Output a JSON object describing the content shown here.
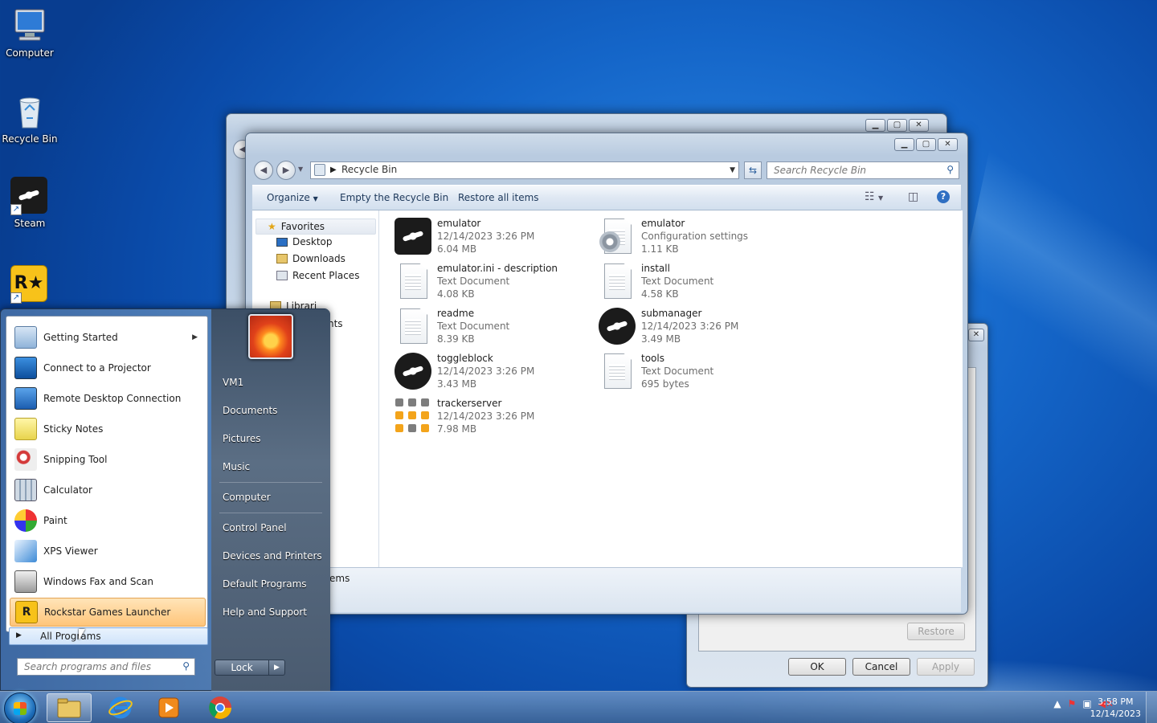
{
  "desktop": {
    "icons": [
      {
        "label": "Computer"
      },
      {
        "label": "Recycle Bin"
      },
      {
        "label": "Steam"
      },
      {
        "label": "Rockstar"
      }
    ]
  },
  "explorer": {
    "address": "Recycle Bin",
    "search_placeholder": "Search Recycle Bin",
    "toolbar": {
      "organize": "Organize",
      "empty": "Empty the Recycle Bin",
      "restore_all": "Restore all items"
    },
    "nav": {
      "favorites": "Favorites",
      "desktop": "Desktop",
      "downloads": "Downloads",
      "recent": "Recent Places",
      "libraries_partial": "Librari",
      "documents_partial": "nts"
    },
    "status_partial": "ems",
    "files": [
      {
        "name": "emulator",
        "line1": "12/14/2023 3:26 PM",
        "line2": "6.04 MB",
        "icon": "steam-icon"
      },
      {
        "name": "emulator",
        "line1": "Configuration settings",
        "line2": "1.11 KB",
        "icon": "config-file-icon"
      },
      {
        "name": "emulator.ini - description",
        "line1": "Text Document",
        "line2": "4.08 KB",
        "icon": "text-document-icon"
      },
      {
        "name": "install",
        "line1": "Text Document",
        "line2": "4.58 KB",
        "icon": "text-document-icon"
      },
      {
        "name": "readme",
        "line1": "Text Document",
        "line2": "8.39 KB",
        "icon": "text-document-icon"
      },
      {
        "name": "submanager",
        "line1": "12/14/2023 3:26 PM",
        "line2": "3.49 MB",
        "icon": "steam-icon"
      },
      {
        "name": "toggleblock",
        "line1": "12/14/2023 3:26 PM",
        "line2": "3.43 MB",
        "icon": "steam-icon"
      },
      {
        "name": "tools",
        "line1": "Text Document",
        "line2": "695 bytes",
        "icon": "text-document-icon"
      },
      {
        "name": "trackerserver",
        "line1": "12/14/2023 3:26 PM",
        "line2": "7.98 MB",
        "icon": "tracker-icon"
      }
    ]
  },
  "dialog": {
    "restore": "Restore",
    "ok": "OK",
    "cancel": "Cancel",
    "apply": "Apply"
  },
  "start_menu": {
    "programs": [
      {
        "label": "Getting Started",
        "submenu": true
      },
      {
        "label": "Connect to a Projector"
      },
      {
        "label": "Remote Desktop Connection"
      },
      {
        "label": "Sticky Notes"
      },
      {
        "label": "Snipping Tool"
      },
      {
        "label": "Calculator"
      },
      {
        "label": "Paint"
      },
      {
        "label": "XPS Viewer"
      },
      {
        "label": "Windows Fax and Scan"
      },
      {
        "label": "Rockstar Games Launcher"
      }
    ],
    "all_programs": "All Programs",
    "search_placeholder": "Search programs and files",
    "right": [
      "VM1",
      "Documents",
      "Pictures",
      "Music",
      "Computer",
      "Control Panel",
      "Devices and Printers",
      "Default Programs",
      "Help and Support"
    ],
    "lock": "Lock"
  },
  "taskbar": {
    "time": "3:58 PM",
    "date": "12/14/2023"
  },
  "colors": {
    "accent": "#1465c8",
    "highlight": "#ffc57a"
  }
}
